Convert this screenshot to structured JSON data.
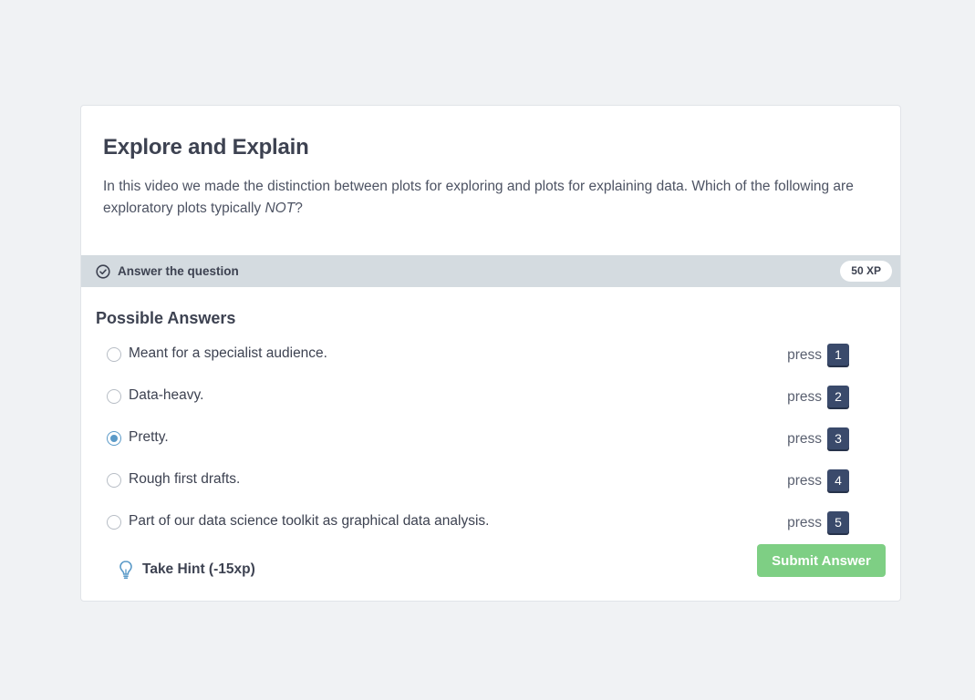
{
  "exercise": {
    "title": "Explore and Explain",
    "prompt_before": "In this video we made the distinction between plots for exploring and plots for explaining data. Which of the following are exploratory plots typically ",
    "prompt_emphasis": "NOT",
    "prompt_after": "?"
  },
  "task": {
    "label": "Answer the question",
    "xp": "50 XP",
    "icon": "check-circle-icon"
  },
  "answers": {
    "heading": "Possible Answers",
    "press_label": "press",
    "selected": 3,
    "options": [
      {
        "text": "Meant for a specialist audience.",
        "key": "1"
      },
      {
        "text": "Data-heavy.",
        "key": "2"
      },
      {
        "text": "Pretty.",
        "key": "3"
      },
      {
        "text": "Rough first drafts.",
        "key": "4"
      },
      {
        "text": "Part of our data science toolkit as graphical data analysis.",
        "key": "5"
      }
    ]
  },
  "hint": {
    "label": "Take Hint (-15xp)",
    "icon": "lightbulb-icon"
  },
  "submit": {
    "label": "Submit Answer",
    "color": "#7ecf84"
  },
  "colors": {
    "background": "#f0f2f4",
    "task_bar": "#d4dbe0",
    "key_badge": "#3a4a6b",
    "radio_selected": "#5b9ac8"
  }
}
